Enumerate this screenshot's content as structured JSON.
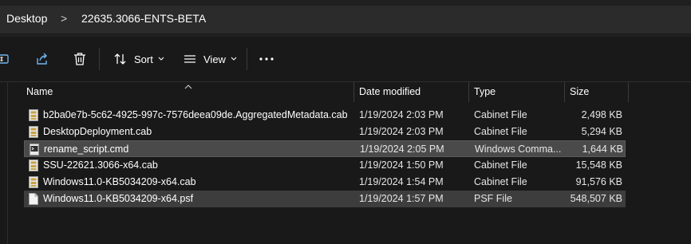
{
  "breadcrumb": {
    "items": [
      "Desktop",
      "22635.3066-ENTS-BETA"
    ],
    "separator": ">"
  },
  "toolbar": {
    "sort_label": "Sort",
    "view_label": "View"
  },
  "columns": {
    "name": "Name",
    "date": "Date modified",
    "type": "Type",
    "size": "Size"
  },
  "files": [
    {
      "name": "b2ba0e7b-5c62-4925-997c-7576deea09de.AggregatedMetadata.cab",
      "date": "1/19/2024 2:03 PM",
      "type": "Cabinet File",
      "size": "2,498 KB",
      "icon": "cabinet-file-icon"
    },
    {
      "name": "DesktopDeployment.cab",
      "date": "1/19/2024 2:03 PM",
      "type": "Cabinet File",
      "size": "5,294 KB",
      "icon": "cabinet-file-icon"
    },
    {
      "name": "rename_script.cmd",
      "date": "1/19/2024 2:05 PM",
      "type": "Windows Comma...",
      "size": "1,644 KB",
      "icon": "script-file-icon"
    },
    {
      "name": "SSU-22621.3066-x64.cab",
      "date": "1/19/2024 1:50 PM",
      "type": "Cabinet File",
      "size": "15,548 KB",
      "icon": "cabinet-file-icon"
    },
    {
      "name": "Windows11.0-KB5034209-x64.cab",
      "date": "1/19/2024 1:54 PM",
      "type": "Cabinet File",
      "size": "91,576 KB",
      "icon": "cabinet-file-icon"
    },
    {
      "name": "Windows11.0-KB5034209-x64.psf",
      "date": "1/19/2024 1:57 PM",
      "type": "PSF File",
      "size": "548,507 KB",
      "icon": "blank-file-icon"
    }
  ],
  "colors": {
    "background": "#191919",
    "selection": "#4a4a4a",
    "address_bar": "#2b2b2b"
  }
}
